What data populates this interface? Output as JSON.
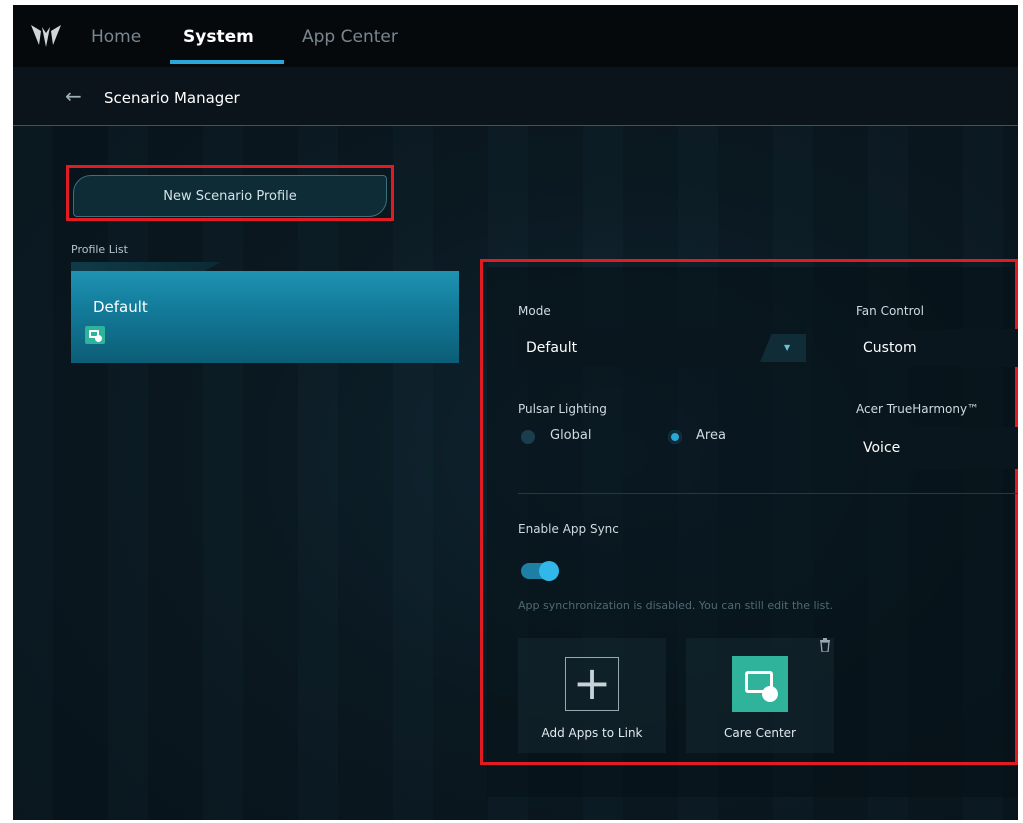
{
  "nav": {
    "tabs": [
      {
        "label": "Home"
      },
      {
        "label": "System"
      },
      {
        "label": "App Center"
      }
    ],
    "active_tab": "System"
  },
  "breadcrumb": {
    "title": "Scenario Manager",
    "back_icon": "arrow-left-icon"
  },
  "sidebar": {
    "new_profile_label": "New Scenario Profile",
    "profile_list_label": "Profile List",
    "profiles": [
      {
        "name": "Default",
        "app_icon": "care-center-icon",
        "selected": true
      }
    ]
  },
  "settings": {
    "mode": {
      "label": "Mode",
      "value": "Default"
    },
    "fan_control": {
      "label": "Fan Control",
      "value": "Custom"
    },
    "pulsar_lighting": {
      "label": "Pulsar Lighting",
      "options": [
        {
          "label": "Global",
          "selected": false
        },
        {
          "label": "Area",
          "selected": true
        }
      ]
    },
    "true_harmony": {
      "label": "Acer TrueHarmony™",
      "value": "Voice"
    },
    "app_sync": {
      "label": "Enable App Sync",
      "enabled": true,
      "hint": "App synchronization is disabled. You can still edit the list."
    },
    "apps": [
      {
        "label": "Add Apps to Link",
        "icon": "plus-icon"
      },
      {
        "label": "Care Center",
        "icon": "care-center-icon"
      }
    ]
  },
  "colors": {
    "accent": "#2aa6d8",
    "highlight_box": "#e21b22",
    "profile_selected": "#1a8aa8"
  }
}
